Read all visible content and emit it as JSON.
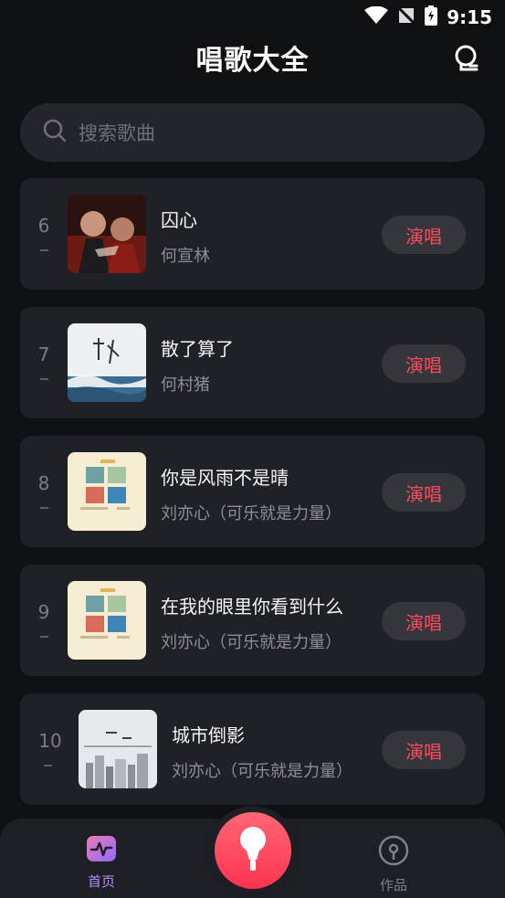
{
  "status": {
    "time": "9:15"
  },
  "header": {
    "title": "唱歌大全"
  },
  "search": {
    "placeholder": "搜索歌曲"
  },
  "songs": [
    {
      "rank": "6",
      "title": "囚心",
      "artist": "何宣林",
      "action": "演唱",
      "cover": "cover-drama"
    },
    {
      "rank": "7",
      "title": "散了算了",
      "artist": "何村猪",
      "action": "演唱",
      "cover": "cover-sea"
    },
    {
      "rank": "8",
      "title": "你是风雨不是晴",
      "artist": "刘亦心（可乐就是力量）",
      "action": "演唱",
      "cover": "cover-collage"
    },
    {
      "rank": "9",
      "title": "在我的眼里你看到什么",
      "artist": "刘亦心（可乐就是力量）",
      "action": "演唱",
      "cover": "cover-collage"
    },
    {
      "rank": "10",
      "title": "城市倒影",
      "artist": "刘亦心（可乐就是力量）",
      "action": "演唱",
      "cover": "cover-city"
    }
  ],
  "tabs": {
    "home": "首页",
    "works": "作品"
  },
  "colors": {
    "accent": "#ff4a5e",
    "tab_active": "#b28cff",
    "background": "#0f1013",
    "card": "#1f2126"
  }
}
